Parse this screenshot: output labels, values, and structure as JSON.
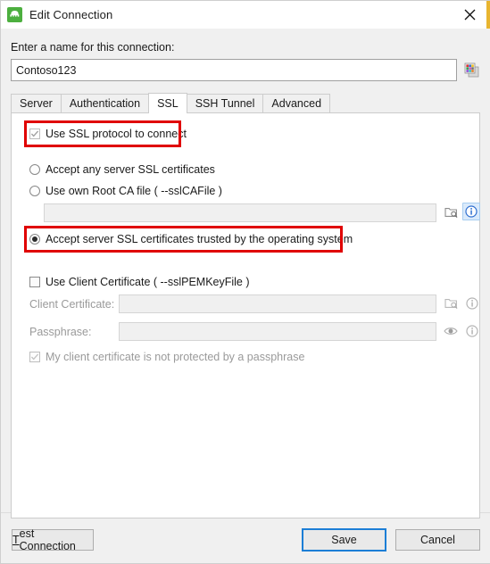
{
  "window": {
    "title": "Edit Connection",
    "app_icon": "mongodb-leaf-icon",
    "close_icon": "close-icon",
    "accent_edge_color": "#e8b530"
  },
  "form": {
    "name_label": "Enter a name for this connection:",
    "name_value": "Contoso123",
    "name_placeholder": "",
    "palette_icon": "color-palette-icon"
  },
  "tabs": [
    {
      "label": "Server",
      "active": false
    },
    {
      "label": "Authentication",
      "active": false
    },
    {
      "label": "SSL",
      "active": true
    },
    {
      "label": "SSH Tunnel",
      "active": false
    },
    {
      "label": "Advanced",
      "active": false
    }
  ],
  "ssl": {
    "use_ssl_label": "Use SSL protocol to connect",
    "use_ssl_checked": true,
    "radio_any_label": "Accept any server SSL certificates",
    "radio_any_selected": false,
    "radio_rootca_label": "Use own Root CA file ( --sslCAFile )",
    "radio_rootca_selected": false,
    "rootca_value": "",
    "rootca_browse_icon": "folder-browse-icon",
    "rootca_info_icon": "info-icon",
    "radio_os_trusted_label": "Accept server SSL certificates trusted by the operating system",
    "radio_os_trusted_selected": true,
    "use_client_cert_label": "Use Client Certificate ( --sslPEMKeyFile )",
    "use_client_cert_checked": false,
    "client_cert_label": "Client Certificate:",
    "client_cert_value": "",
    "client_cert_browse_icon": "folder-browse-icon",
    "client_cert_info_icon": "info-icon",
    "passphrase_label": "Passphrase:",
    "passphrase_value": "",
    "passphrase_reveal_icon": "eye-icon",
    "passphrase_info_icon": "info-icon",
    "no_passphrase_label": "My client certificate is not protected by a passphrase",
    "no_passphrase_checked": true,
    "highlight_color": "#e00000"
  },
  "footer": {
    "test_connection_mnemonic": "T",
    "test_connection_rest": "est Connection",
    "save_label": "Save",
    "cancel_label": "Cancel"
  }
}
